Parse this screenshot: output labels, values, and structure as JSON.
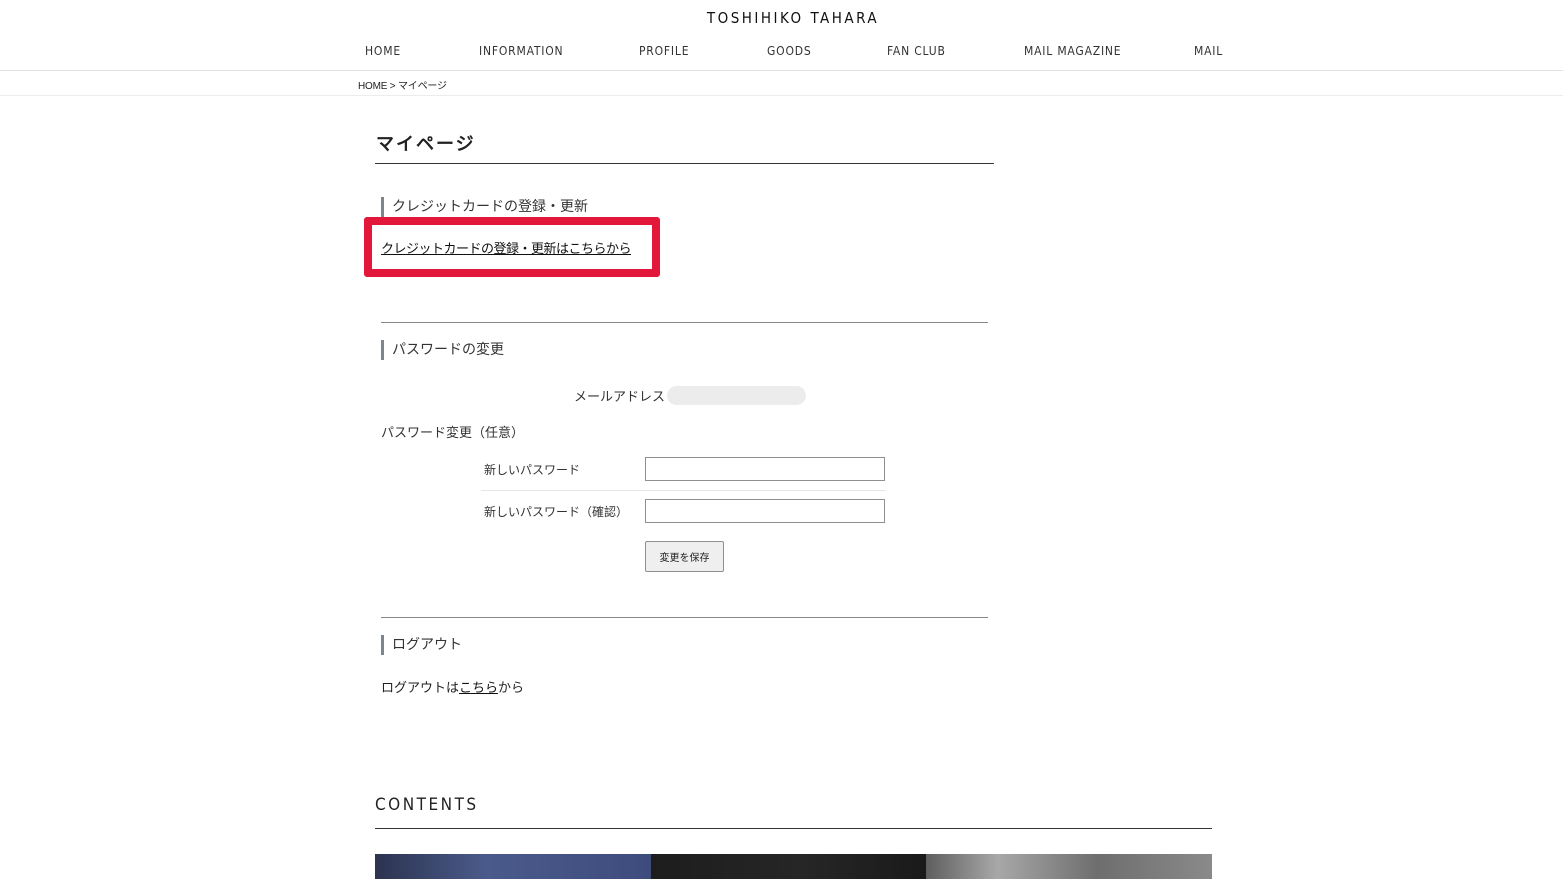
{
  "site": {
    "title": "TOSHIHIKO TAHARA"
  },
  "nav": {
    "items": [
      {
        "label": "HOME"
      },
      {
        "label": "INFORMATION"
      },
      {
        "label": "PROFILE"
      },
      {
        "label": "GOODS"
      },
      {
        "label": "FAN CLUB"
      },
      {
        "label": "MAIL MAGAZINE"
      },
      {
        "label": "MAIL"
      }
    ]
  },
  "breadcrumb": {
    "home": "HOME",
    "separator": " > ",
    "current": "マイページ"
  },
  "page": {
    "title": "マイページ"
  },
  "credit_card": {
    "heading": "クレジットカードの登録・更新",
    "link": "クレジットカードの登録・更新はこちらから",
    "highlight_color": "#e3173a"
  },
  "password": {
    "heading": "パスワードの変更",
    "email_label": "メールアドレス",
    "change_label": "パスワード変更（任意）",
    "new_password_label": "新しいパスワード",
    "new_password_confirm_label": "新しいパスワード（確認）",
    "new_password_value": "",
    "new_password_confirm_value": "",
    "save_button": "変更を保存"
  },
  "logout": {
    "heading": "ログアウト",
    "prefix": "ログアウトは",
    "link": "こちら",
    "suffix": "から"
  },
  "contents": {
    "title": "CONTENTS"
  }
}
